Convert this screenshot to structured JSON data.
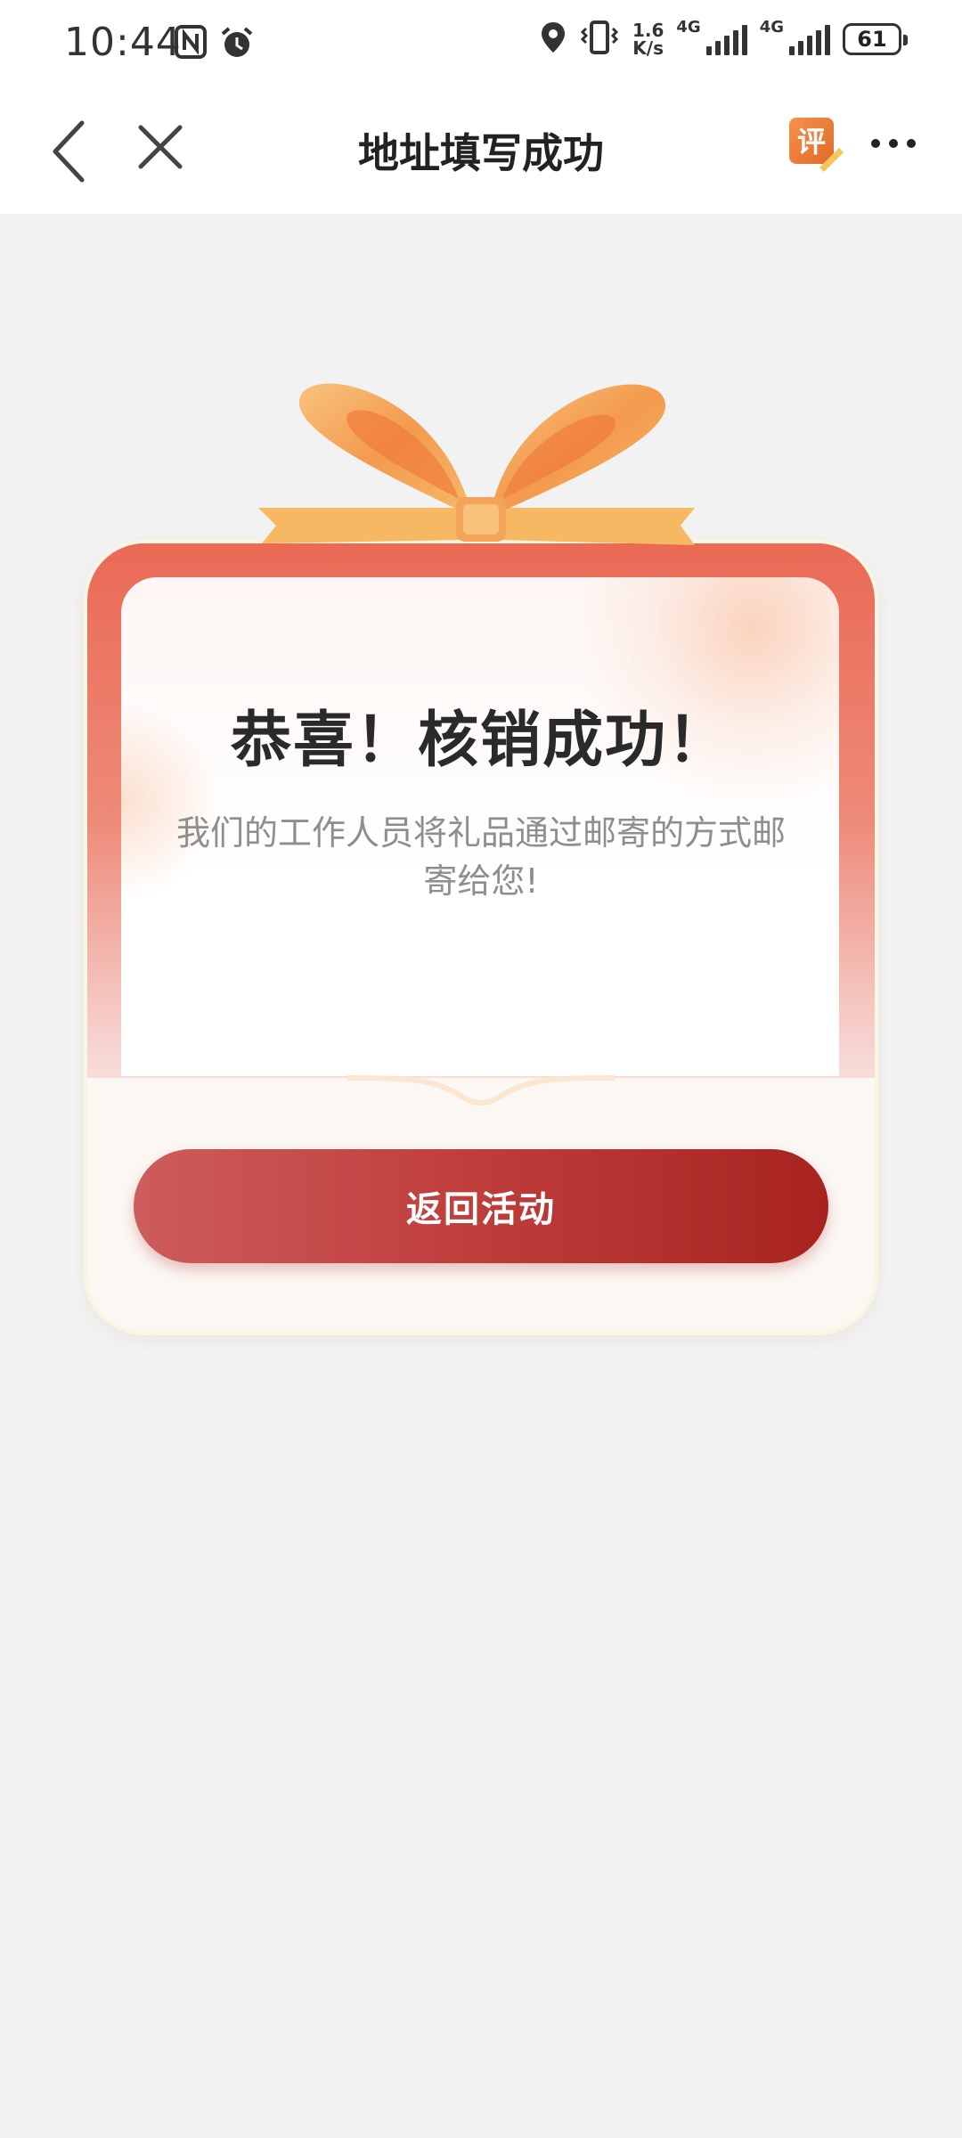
{
  "status_bar": {
    "time": "10:44",
    "net_speed_value": "1.6",
    "net_speed_unit": "K/s",
    "sim1_label": "4G",
    "sim2_label": "4G",
    "battery": "61"
  },
  "nav": {
    "title": "地址填写成功",
    "rate_icon_text": "评"
  },
  "card": {
    "title": "恭喜！核销成功！",
    "description": "我们的工作人员将礼品通过邮寄的方式邮寄给您!",
    "button_label": "返回活动"
  },
  "colors": {
    "button_start": "#cd5c5c",
    "button_end": "#a82320",
    "frame_top": "#ea6a55",
    "bow": "#f4a35a"
  },
  "icons": [
    "nfc-icon",
    "alarm-icon",
    "location-icon",
    "vibrate-icon",
    "signal-icon",
    "battery-icon",
    "back-icon",
    "close-icon",
    "rate-icon",
    "more-icon",
    "gift-bow-icon"
  ]
}
